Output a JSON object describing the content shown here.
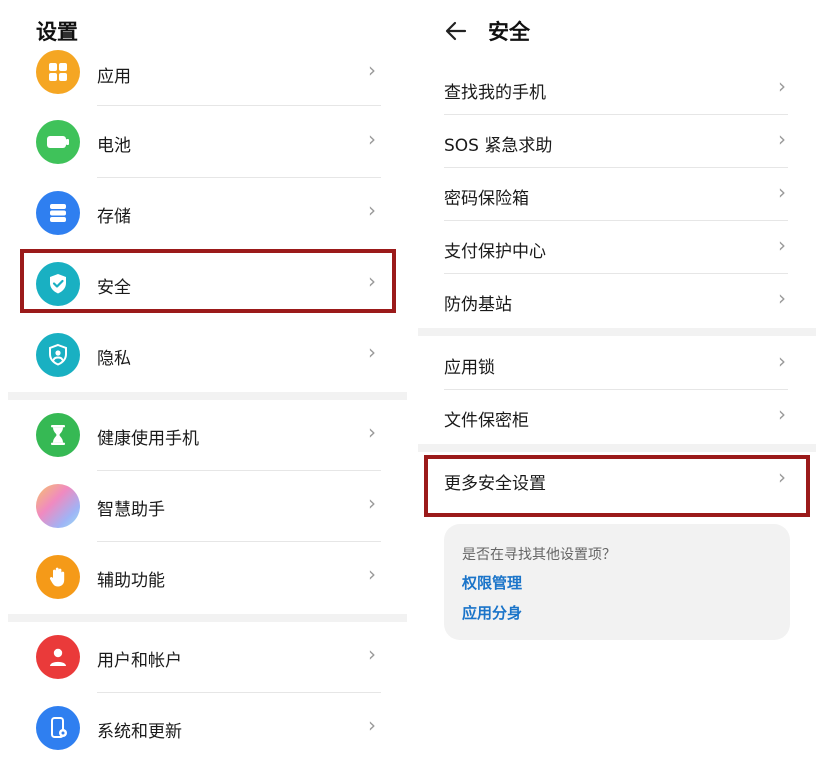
{
  "left": {
    "title": "设置",
    "items": [
      {
        "label": "应用",
        "icon": "grid-icon",
        "color": "#f5a623"
      },
      {
        "label": "电池",
        "icon": "battery-icon",
        "color": "#3fc25a"
      },
      {
        "label": "存储",
        "icon": "storage-icon",
        "color": "#2f7ff0"
      },
      {
        "label": "安全",
        "icon": "shield-check-icon",
        "color": "#19b0c2"
      },
      {
        "label": "隐私",
        "icon": "privacy-icon",
        "color": "#19b0c2"
      },
      {
        "label": "健康使用手机",
        "icon": "hourglass-icon",
        "color": "#36b954"
      },
      {
        "label": "智慧助手",
        "icon": "assistant-orb-icon",
        "color": "#c9a6f0"
      },
      {
        "label": "辅助功能",
        "icon": "hand-icon",
        "color": "#f59a18"
      },
      {
        "label": "用户和帐户",
        "icon": "user-icon",
        "color": "#ea3a3a"
      },
      {
        "label": "系统和更新",
        "icon": "phone-settings-icon",
        "color": "#2f7ff0"
      }
    ]
  },
  "right": {
    "title": "安全",
    "back_icon": "back-arrow-icon",
    "items": [
      {
        "label": "查找我的手机"
      },
      {
        "label": "SOS 紧急求助"
      },
      {
        "label": "密码保险箱"
      },
      {
        "label": "支付保护中心"
      },
      {
        "label": "防伪基站"
      },
      {
        "label": "应用锁"
      },
      {
        "label": "文件保密柜"
      },
      {
        "label": "更多安全设置"
      }
    ],
    "suggest": {
      "question": "是否在寻找其他设置项？",
      "links": [
        "权限管理",
        "应用分身"
      ]
    }
  },
  "chevron": "›",
  "highlight_color": "#9b1a1a"
}
